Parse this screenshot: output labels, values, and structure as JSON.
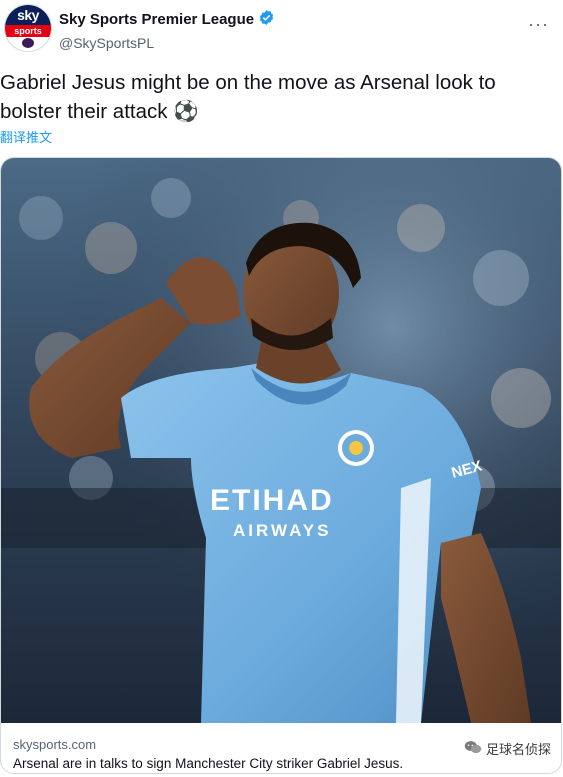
{
  "account": {
    "display_name": "Sky Sports Premier League",
    "handle": "@SkySportsPL",
    "verified_icon": "verified-badge-icon",
    "avatar_text_top": "sky",
    "avatar_text_bottom": "sports"
  },
  "tweet": {
    "text": "Gabriel Jesus might be on the move as Arsenal look to bolster their attack ⚽",
    "translate_label": "翻译推文",
    "more_icon": "···"
  },
  "card": {
    "domain": "skysports.com",
    "description": "Arsenal are in talks to sign Manchester City striker Gabriel Jesus.",
    "shirt_sponsor_top": "ETIHAD",
    "shirt_sponsor_bottom": "AIRWAYS",
    "sleeve_text": "NEX"
  },
  "watermark": {
    "text": "足球名侦探",
    "icon": "wechat-icon"
  },
  "colors": {
    "link": "#1d9bf0",
    "verified": "#1d9bf0",
    "secondary_text": "#536471",
    "shirt": "#6cabdd"
  }
}
